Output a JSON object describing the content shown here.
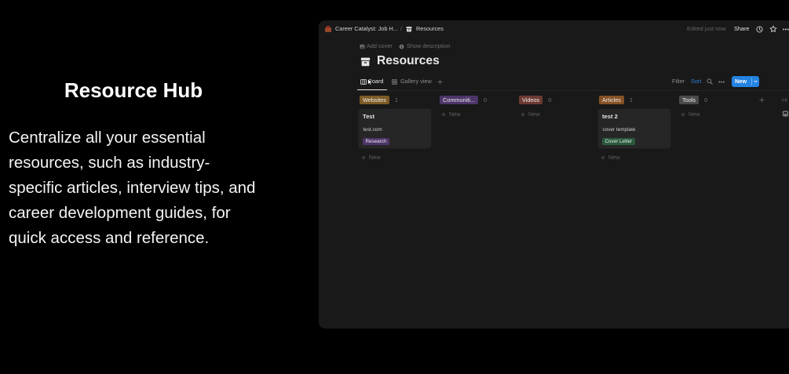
{
  "feature": {
    "heading": "Resource Hub",
    "description_lines": [
      "Centralize all your essential",
      "resources, such as industry-",
      "specific articles, interview tips, and",
      "career development guides, for",
      "quick access and reference."
    ]
  },
  "app": {
    "breadcrumb": {
      "workspace_icon": "workspace-icon",
      "workspace": "Career Catalyst: Job H...",
      "separator": "/",
      "page_icon": "archive-icon",
      "page": "Resources"
    },
    "topbar": {
      "edited": "Edited just now",
      "share": "Share",
      "icons": [
        "clock-icon",
        "star-icon",
        "more-icon"
      ]
    },
    "page_actions": {
      "add_cover": "Add cover",
      "show_description": "Show description"
    },
    "page_title": "Resources",
    "views": {
      "tabs": [
        {
          "label": "Board",
          "icon": "board-icon",
          "active": true
        },
        {
          "label": "Gallery view",
          "icon": "gallery-icon",
          "active": false
        }
      ]
    },
    "toolbar": {
      "filter": "Filter",
      "sort": "Sort",
      "new": "New"
    },
    "board": {
      "groups": [
        {
          "name": "Websites",
          "count": 1,
          "color": "#7c5a26",
          "cards": [
            {
              "title": "Test",
              "property": "test.com",
              "tag": "Research",
              "tag_color": "#4d3568"
            }
          ]
        },
        {
          "name": "Communiti...",
          "count": 0,
          "color": "#4d3568",
          "cards": []
        },
        {
          "name": "Videos",
          "count": 0,
          "color": "#6b3a33",
          "cards": []
        },
        {
          "name": "Articles",
          "count": 1,
          "color": "#855125",
          "cards": [
            {
              "title": "test 2",
              "property": "cover template",
              "tag": "Cover Letter",
              "tag_color": "#2b5a3d"
            }
          ]
        },
        {
          "name": "Tools",
          "count": 0,
          "color": "#4a4a4a",
          "cards": []
        }
      ],
      "new_item_label": "New",
      "hidden_groups": "Hi"
    }
  },
  "colors": {
    "page_bg": "#000000",
    "window_bg": "#191919",
    "card_bg": "#262626",
    "accent_blue": "#2383e2"
  }
}
